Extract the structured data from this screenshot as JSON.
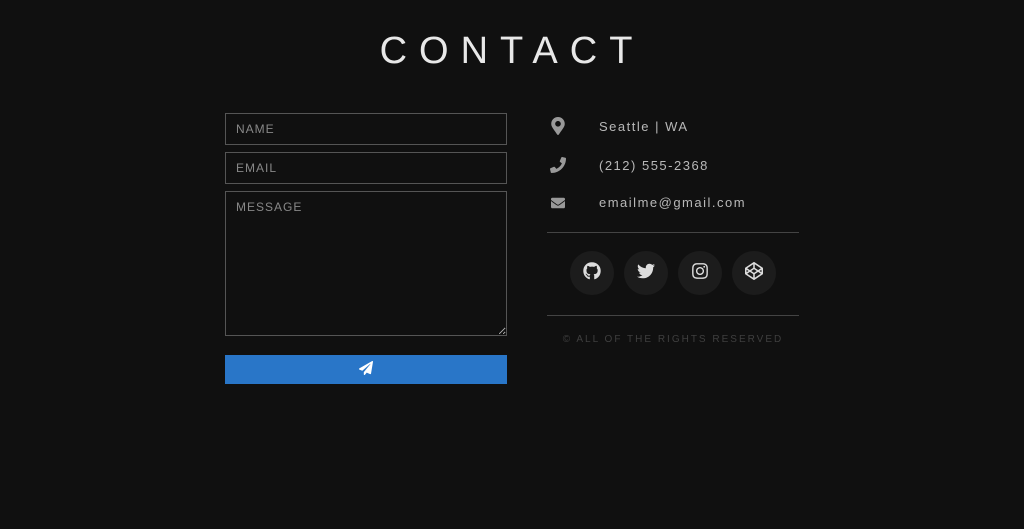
{
  "title": "CONTACT",
  "form": {
    "name_placeholder": "NAME",
    "email_placeholder": "EMAIL",
    "message_placeholder": "MESSAGE"
  },
  "info": {
    "location": "Seattle | WA",
    "phone": "(212) 555-2368",
    "email": "emailme@gmail.com"
  },
  "socials": {
    "github": "github-icon",
    "twitter": "twitter-icon",
    "instagram": "instagram-icon",
    "codepen": "codepen-icon"
  },
  "copyright": "© ALL OF THE RIGHTS RESERVED"
}
